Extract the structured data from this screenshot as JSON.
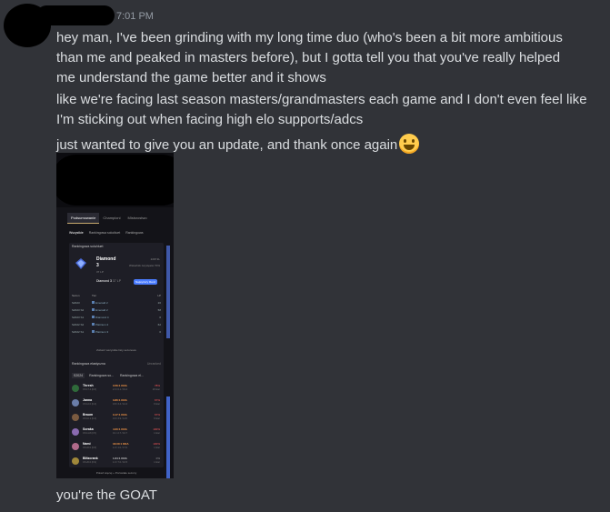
{
  "message": {
    "time": "7:01 PM",
    "lines": [
      "hey man, I've been grinding with my long time duo (who's been a bit more ambitious",
      "than me and peaked in masters before), but I gotta tell you that you've really helped",
      "me understand the game better and it shows",
      "like we're facing last season masters/grandmasters each game and I don't even feel like",
      "I'm sticking out when facing high elo supports/adcs",
      "just wanted to give you an update, and thank once again"
    ],
    "emoji": "grinning-face-emoji",
    "final": "you're the GOAT"
  },
  "embed": {
    "tabs": [
      "Podsumowanie",
      "Championi",
      "Mistrzostwo"
    ],
    "subtabs": [
      "Wszystkie",
      "Rankingowa solo/duet",
      "Rankingowa"
    ],
    "solo": {
      "title": "Rankingowa solo/duet",
      "tier": "Diamond",
      "division": "3",
      "lp": "37 LP",
      "wins_losses": "22W 9L",
      "winrate": "Wskaźnik zwycięstw 70%",
      "line": "Diamond 3",
      "line_lp": "37 LP",
      "badge": "Najwyższy Ranż",
      "history_head": [
        "Sezon",
        "Tier",
        "LP"
      ],
      "history": [
        {
          "season": "S2023",
          "tier": "Emerald 2",
          "lp": "20"
        },
        {
          "season": "S2023 S2",
          "tier": "Emerald 2",
          "lp": "58"
        },
        {
          "season": "S2023 S1",
          "tier": "Diamond 4",
          "lp": "0"
        },
        {
          "season": "S2022 S2",
          "tier": "Platinum 2",
          "lp": "62"
        },
        {
          "season": "S2022 S1",
          "tier": "Platinum 3",
          "lp": "0"
        }
      ],
      "show_more": "Zobacz wszystkie listy sezonowe"
    },
    "flex": {
      "title": "Rankingowa elastyczna",
      "status": "Unranked",
      "tabs": [
        "S2024",
        "Rankingowa so...",
        "Rankingowa el..."
      ],
      "champions": [
        {
          "name": "Thresh",
          "cs": "CS 17.4 (0.6)",
          "kda": "3.56:1 KDA",
          "kda_detail": "2.3 / 6.1 / 19.4",
          "wr": "78%",
          "games": "18 Gier"
        },
        {
          "name": "Janna",
          "cs": "CS 12.0 (0.4)",
          "kda": "3.80:1 KDA",
          "kda_detail": "0.8 / 3.4 / 12.4",
          "wr": "67%",
          "games": "6 Gier"
        },
        {
          "name": "Braum",
          "cs": "CS 10.1 (0.4)",
          "kda": "3.17:1 KDA",
          "kda_detail": "0.9 / 3.9 / 11.5",
          "wr": "67%",
          "games": "6 Gier"
        },
        {
          "name": "Soraka",
          "cs": "CS 11.8 (0.5)",
          "kda": "4.00:1 KDA",
          "kda_detail": "0.1 / 2.7 / 10.7",
          "wr": "100%",
          "games": "1 Gier"
        },
        {
          "name": "Nami",
          "cs": "CS 22.0 (0.8)",
          "kda": "18.00:1 KDA",
          "kda_detail": "1.0 / 1.0 / 17.0",
          "wr": "100%",
          "games": "1 Gier"
        },
        {
          "name": "Blitzcrank",
          "cs": "CS 20.0 (0.9)",
          "kda": "1.64:1 KDA",
          "kda_detail": "1.0 / 7.0 / 10.5",
          "wr": "0%",
          "games": "1 Gier"
        }
      ],
      "footer": "Pokaż więcej + Pozostałe sezony"
    }
  },
  "colors": {
    "background": "#313338",
    "text": "#dbdee1",
    "timestamp": "#949ba4"
  }
}
